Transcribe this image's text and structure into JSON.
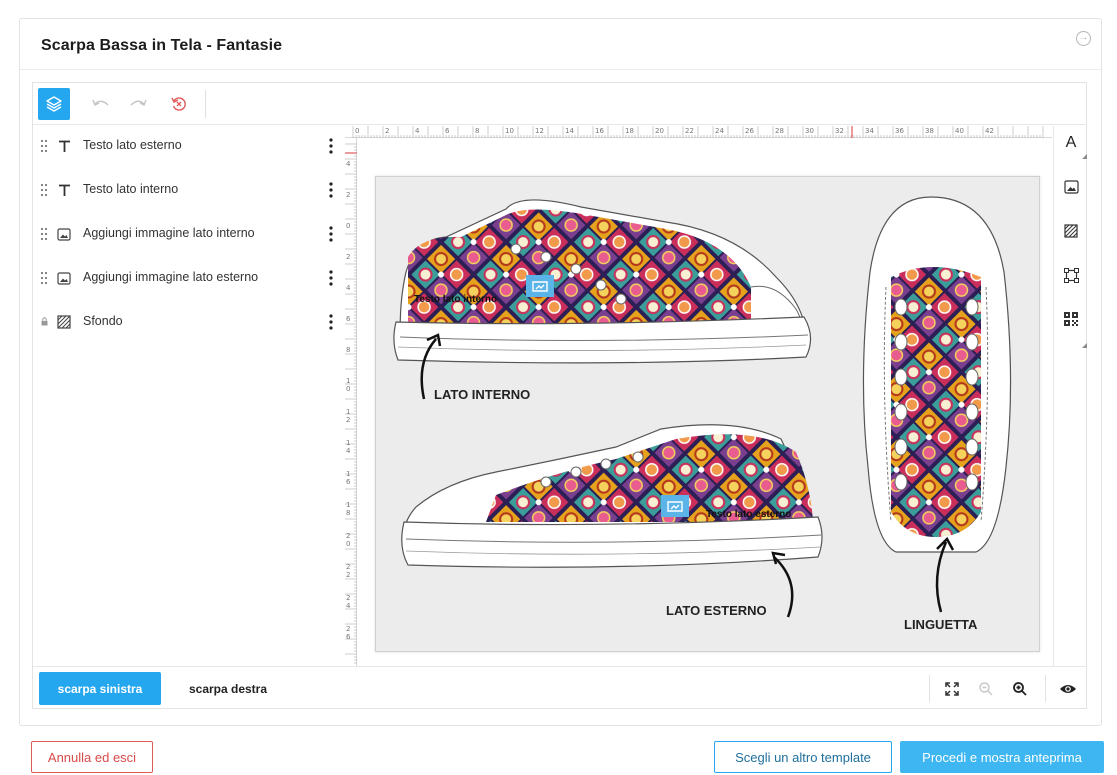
{
  "header": {
    "title": "Scarpa Bassa in Tela - Fantasie"
  },
  "layers": [
    {
      "name": "Testo lato esterno",
      "icon": "text-icon"
    },
    {
      "name": "Testo lato interno",
      "icon": "text-icon"
    },
    {
      "name": "Aggiungi immagine lato interno",
      "icon": "image-icon"
    },
    {
      "name": "Aggiungi immagine lato esterno",
      "icon": "image-icon"
    },
    {
      "name": "Sfondo",
      "icon": "background-icon",
      "locked": true
    }
  ],
  "ruler": {
    "top": [
      "0",
      "2",
      "4",
      "6",
      "8",
      "10",
      "12",
      "14",
      "16",
      "18",
      "20",
      "22",
      "24",
      "26",
      "28",
      "30",
      "32",
      "34",
      "36",
      "38",
      "40",
      "42"
    ],
    "left": [
      "4",
      "2",
      "0",
      "2",
      "4",
      "6",
      "8",
      "10",
      "12",
      "14",
      "16",
      "18",
      "20",
      "22",
      "24",
      "26"
    ]
  },
  "canvas": {
    "label_inner": "LATO INTERNO",
    "label_outer": "LATO ESTERNO",
    "label_tongue": "LINGUETTA",
    "text_inner": "Testo lato interno",
    "text_outer": "Testo lato esterno"
  },
  "tabs": {
    "left": "scarpa sinistra",
    "right": "scarpa destra"
  },
  "footer": {
    "cancel": "Annulla ed esci",
    "template": "Scegli un altro template",
    "proceed": "Procedi e mostra anteprima"
  },
  "colors": {
    "accent": "#25a7f0",
    "danger": "#d94a4a",
    "artboard": "#ececec"
  }
}
